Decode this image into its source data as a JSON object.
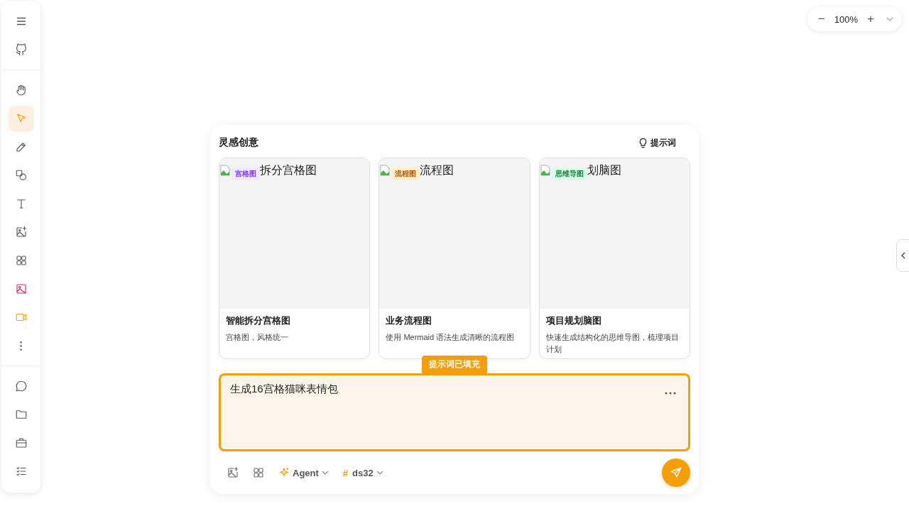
{
  "sidebar": {
    "top": [
      {
        "selected": false
      },
      {
        "selected": false
      }
    ],
    "tools": [
      {
        "selected": false
      },
      {
        "selected": true
      },
      {
        "selected": false
      },
      {
        "selected": false
      },
      {
        "selected": false
      },
      {
        "selected": false
      },
      {
        "selected": false
      },
      {
        "selected": false
      },
      {
        "selected": false
      },
      {
        "selected": false
      }
    ],
    "bottom": [
      {
        "selected": false
      },
      {
        "selected": false
      },
      {
        "selected": false
      },
      {
        "selected": false
      }
    ]
  },
  "zoom": {
    "minus": "−",
    "value": "100%",
    "plus": "+"
  },
  "panel": {
    "title": "灵感创意",
    "prompt_button": "提示词",
    "cards": [
      {
        "alt": "拆分宫格图",
        "tag": "宫格图",
        "color": "#7c3aed",
        "title": "智能拆分宫格图",
        "description": "宫格图，风格统一"
      },
      {
        "alt": "流程图",
        "tag": "流程图",
        "color": "#b45309",
        "title": "业务流程图",
        "description": "使用 Mermaid 语法生成清晰的流程图"
      },
      {
        "alt": "划脑图",
        "tag": "思维导图",
        "color": "#15803d",
        "title": "项目规划脑图",
        "description": "快速生成结构化的思维导图，梳理项目计划"
      }
    ],
    "filled_badge": "提示词已填充",
    "input": {
      "value": "生成16宫格猫咪表情包"
    },
    "agent": "Agent",
    "model_prefix": "#",
    "model": "ds32"
  }
}
